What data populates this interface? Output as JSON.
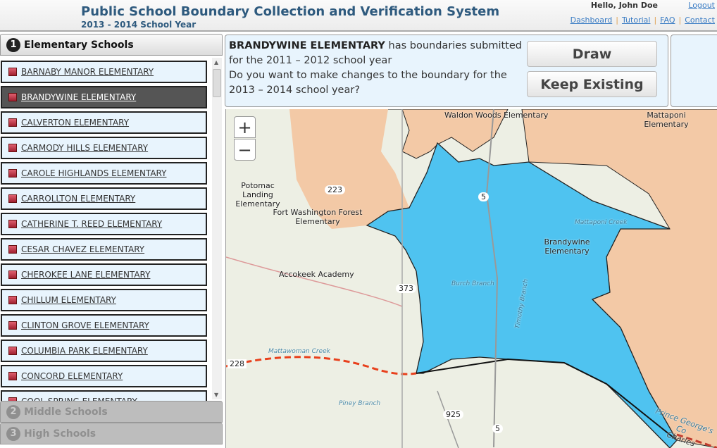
{
  "header": {
    "title": "Public School Boundary Collection and Verification System",
    "subtitle": "2013 - 2014 School Year",
    "greeting": "Hello, John Doe",
    "logout": "Logout",
    "nav": [
      "Dashboard",
      "Tutorial",
      "FAQ",
      "Contact"
    ]
  },
  "sidebar": {
    "sections": [
      {
        "num": "1",
        "label": "Elementary Schools"
      },
      {
        "num": "2",
        "label": "Middle Schools"
      },
      {
        "num": "3",
        "label": "High Schools"
      }
    ],
    "schools": [
      "BARNABY MANOR ELEMENTARY",
      "BRANDYWINE ELEMENTARY",
      "CALVERTON ELEMENTARY",
      "CARMODY HILLS ELEMENTARY",
      "CAROLE HIGHLANDS ELEMENTARY",
      "CARROLLTON ELEMENTARY",
      "CATHERINE T. REED ELEMENTARY",
      "CESAR CHAVEZ ELEMENTARY",
      "CHEROKEE LANE ELEMENTARY",
      "CHILLUM ELEMENTARY",
      "CLINTON GROVE ELEMENTARY",
      "COLUMBIA PARK ELEMENTARY",
      "CONCORD ELEMENTARY",
      "COOL SPRING ELEMENTARY"
    ],
    "selected": "BRANDYWINE ELEMENTARY"
  },
  "prompt": {
    "school": "BRANDYWINE ELEMENTARY",
    "line1": " has boundaries submitted for the 2011 – 2012 school year",
    "line2": "Do you want to make changes to the boundary for the 2013 – 2014 school year?",
    "draw": "Draw",
    "keep": "Keep Existing"
  },
  "map": {
    "zoom_in": "+",
    "zoom_out": "−",
    "labels": [
      "Waldon Woods Elementary",
      "Mattaponi Elementary",
      "Potomac Landing Elementary",
      "Fort Washington Forest Elementary",
      "Brandywine Elementary",
      "Accokeek Academy",
      "223",
      "5",
      "373",
      "228",
      "925",
      "5",
      "Mattawoman Creek",
      "Piney Branch",
      "Burch Branch",
      "Timothy Branch",
      "Mattaponi Creek",
      "Prince George's Co",
      "Charles"
    ]
  },
  "colors": {
    "boundary": "#4fc3f0",
    "neighbor": "#f5c6a0",
    "accent": "#2e5a7e"
  }
}
